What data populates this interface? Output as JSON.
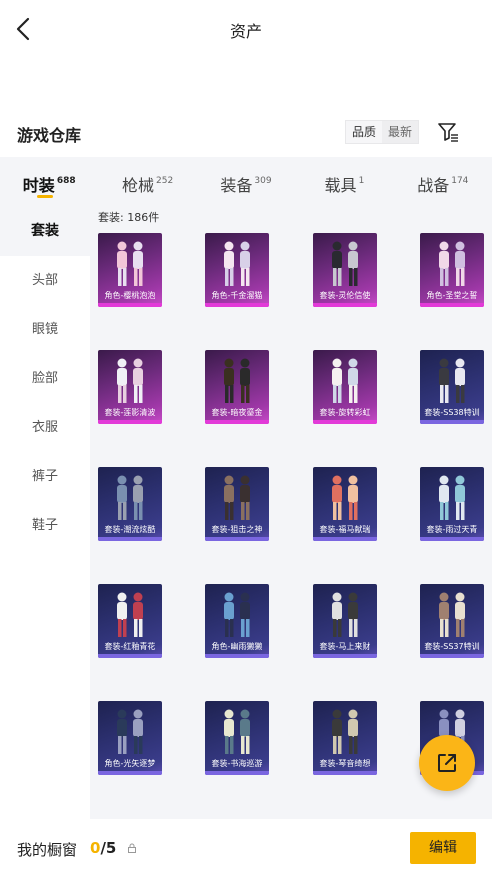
{
  "header": {
    "title": "资产",
    "back_icon": "chevron-left-icon"
  },
  "warehouse": {
    "title": "游戏仓库",
    "sort_options": [
      "品质",
      "最新"
    ],
    "filter_icon": "filter-icon"
  },
  "category_tabs": [
    {
      "label": "时装",
      "count": "688",
      "active": true
    },
    {
      "label": "枪械",
      "count": "252",
      "active": false
    },
    {
      "label": "装备",
      "count": "309",
      "active": false
    },
    {
      "label": "载具",
      "count": "1",
      "active": false
    },
    {
      "label": "战备",
      "count": "174",
      "active": false
    }
  ],
  "sub_categories": [
    {
      "label": "套装",
      "active": true
    },
    {
      "label": "头部",
      "active": false
    },
    {
      "label": "眼镜",
      "active": false
    },
    {
      "label": "脸部",
      "active": false
    },
    {
      "label": "衣服",
      "active": false
    },
    {
      "label": "裤子",
      "active": false
    },
    {
      "label": "鞋子",
      "active": false
    }
  ],
  "content": {
    "count_label": "套装: 186件",
    "items": [
      {
        "name": "角色-樱桃泡泡",
        "quality": "pink"
      },
      {
        "name": "角色-千金溜猫",
        "quality": "pink"
      },
      {
        "name": "套装-灵伦信使",
        "quality": "pink"
      },
      {
        "name": "角色-圣堂之誓",
        "quality": "pink"
      },
      {
        "name": "套装-莲影清波",
        "quality": "pink"
      },
      {
        "name": "套装-暗夜鎏金",
        "quality": "pink"
      },
      {
        "name": "套装-旋转彩虹",
        "quality": "pink"
      },
      {
        "name": "套装-SS38特训",
        "quality": "blue"
      },
      {
        "name": "套装-潮流炫酷",
        "quality": "blue"
      },
      {
        "name": "套装-狙击之神",
        "quality": "blue"
      },
      {
        "name": "套装-福马献瑞",
        "quality": "blue"
      },
      {
        "name": "套装-雨过天青",
        "quality": "blue"
      },
      {
        "name": "套装-红釉青花",
        "quality": "blue"
      },
      {
        "name": "角色-幽雨獭獭",
        "quality": "blue"
      },
      {
        "name": "套装-马上来财",
        "quality": "blue"
      },
      {
        "name": "套装-SS37特训",
        "quality": "blue"
      },
      {
        "name": "角色-光矢逐梦",
        "quality": "blue"
      },
      {
        "name": "套装-书海巡游",
        "quality": "blue"
      },
      {
        "name": "套装-琴音绮想",
        "quality": "blue"
      },
      {
        "name": "套装-",
        "quality": "blue"
      }
    ]
  },
  "share_button": {
    "icon": "share-external-icon"
  },
  "footer": {
    "showcase_label": "我的橱窗",
    "showcase_current": "0",
    "showcase_total": "/5",
    "lock_icon": "lock-icon",
    "edit_label": "编辑"
  },
  "colors": {
    "accent": "#f5b300",
    "pink_quality": "#e23ad8",
    "blue_quality": "#7a66e0"
  }
}
